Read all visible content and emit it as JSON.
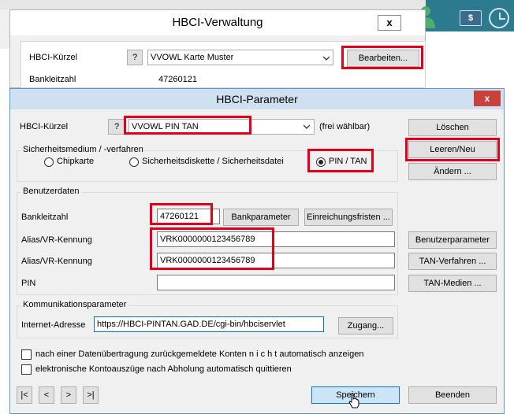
{
  "background": {
    "accent_color": "#2b7a8e",
    "dollar_label": "$"
  },
  "verwaltung": {
    "title": "HBCI-Verwaltung",
    "close_label": "x",
    "kuerzel_label": "HBCI-Kürzel",
    "help_label": "?",
    "kuerzel_value": "VVOWL Karte Muster",
    "edit_button": "Bearbeiten...",
    "blz_label": "Bankleitzahl",
    "blz_value": "47260121"
  },
  "parameter": {
    "title": "HBCI-Parameter",
    "close_label": "x",
    "kuerzel_label": "HBCI-Kürzel",
    "help_label": "?",
    "kuerzel_value": "VVOWL PIN TAN",
    "kuerzel_hint": "(frei wählbar)",
    "security_group": "Sicherheitsmedium / -verfahren",
    "radio_chipkarte": "Chipkarte",
    "radio_diskette": "Sicherheitsdiskette / Sicherheitsdatei",
    "radio_pintan": "PIN / TAN",
    "user_group": "Benutzerdaten",
    "blz_label": "Bankleitzahl",
    "blz_value": "47260121",
    "bankparameter_button": "Bankparameter",
    "einreichung_button": "Einreichungsfristen ...",
    "alias_label_1": "Alias/VR-Kennung",
    "alias_value_1": "VRK0000000123456789",
    "alias_label_2": "Alias/VR-Kennung",
    "alias_value_2": "VRK0000000123456789",
    "pin_label": "PIN",
    "pin_value": "",
    "comm_group": "Kommunikationsparameter",
    "url_label": "Internet-Adresse",
    "url_value": "https://HBCI-PINTAN.GAD.DE/cgi-bin/hbciservlet",
    "zugang_button": "Zugang...",
    "check_1": "nach einer Datenübertragung zurückgemeldete Konten  n i c h t  automatisch anzeigen",
    "check_2": "elektronische Kontoauszüge nach Abholung automatisch quittieren",
    "nav_first": "|<",
    "nav_prev": "<",
    "nav_next": ">",
    "nav_last": ">|",
    "save_button": "Speichern",
    "end_button": "Beenden",
    "delete_button": "Löschen",
    "new_button": "Leeren/Neu",
    "change_button": "Ändern ...",
    "userparam_button": "Benutzerparameter",
    "tanverfahren_button": "TAN-Verfahren ...",
    "tanmedien_button": "TAN-Medien ..."
  }
}
